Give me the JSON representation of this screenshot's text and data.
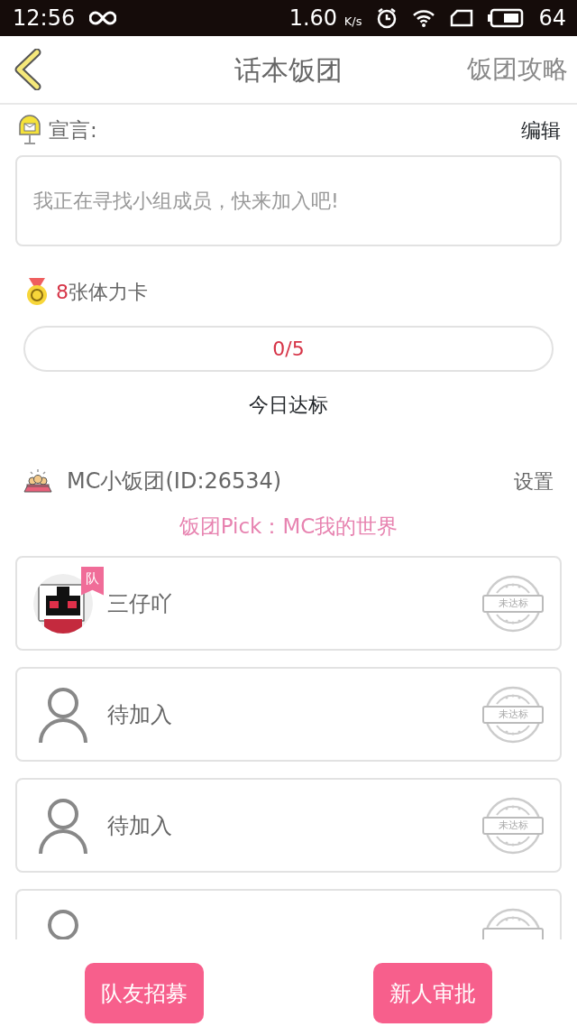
{
  "status_bar": {
    "time": "12:56",
    "speed": "1.60",
    "speed_unit": "K/s",
    "battery": "64"
  },
  "header": {
    "title": "话本饭团",
    "action": "饭团攻略"
  },
  "declaration": {
    "label": "宣言:",
    "edit": "编辑",
    "placeholder": "我正在寻找小组成员，快来加入吧!"
  },
  "stamina": {
    "count": "8",
    "label": "张体力卡"
  },
  "progress": {
    "level": 0,
    "reading": "0/5",
    "caption": "今日达标"
  },
  "group": {
    "name": "MC小饭团(ID:26534)",
    "settings": "设置",
    "pick": "饭团Pick：MC我的世界"
  },
  "members": [
    {
      "kind": "member",
      "name": "三仔吖",
      "badge": "队",
      "stamp": "未达标"
    },
    {
      "kind": "empty",
      "name": "待加入",
      "stamp": "未达标"
    },
    {
      "kind": "empty",
      "name": "待加入",
      "stamp": "未达标"
    },
    {
      "kind": "empty"
    }
  ],
  "buttons": [
    "队友招募",
    "新人审批"
  ]
}
